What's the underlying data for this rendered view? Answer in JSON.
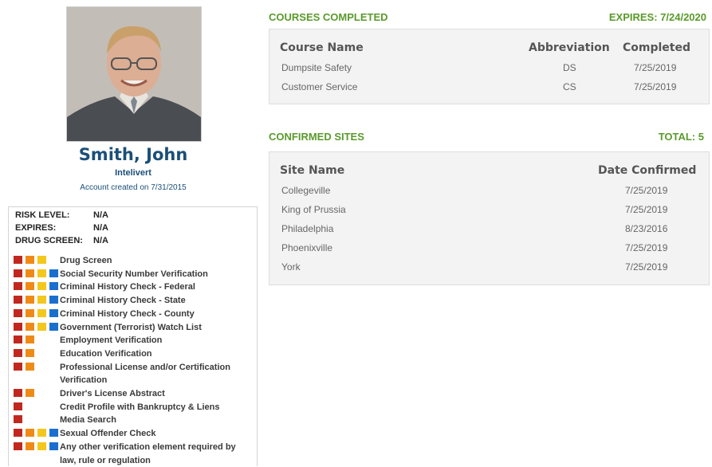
{
  "profile": {
    "name": "Smith, John",
    "company": "Intelivert",
    "created": "Account created on 7/31/2015"
  },
  "risk": {
    "level_label": "RISK LEVEL:",
    "level_value": "N/A",
    "expires_label": "EXPIRES:",
    "expires_value": "N/A",
    "drug_label": "DRUG SCREEN:",
    "drug_value": "N/A"
  },
  "checks": [
    {
      "label": "Drug Screen",
      "colors": [
        "red",
        "orange",
        "yellow"
      ]
    },
    {
      "label": "Social Security Number Verification",
      "colors": [
        "red",
        "orange",
        "yellow",
        "blue"
      ]
    },
    {
      "label": "Criminal History Check - Federal",
      "colors": [
        "red",
        "orange",
        "yellow",
        "blue"
      ]
    },
    {
      "label": "Criminal History Check - State",
      "colors": [
        "red",
        "orange",
        "yellow",
        "blue"
      ]
    },
    {
      "label": "Criminal History Check - County",
      "colors": [
        "red",
        "orange",
        "yellow",
        "blue"
      ]
    },
    {
      "label": "Government (Terrorist) Watch List",
      "colors": [
        "red",
        "orange",
        "yellow",
        "blue"
      ]
    },
    {
      "label": "Employment Verification",
      "colors": [
        "red",
        "orange"
      ]
    },
    {
      "label": "Education Verification",
      "colors": [
        "red",
        "orange"
      ]
    },
    {
      "label": "Professional License and/or Certification Verification",
      "colors": [
        "red",
        "orange"
      ]
    },
    {
      "label": "Driver's License Abstract",
      "colors": [
        "red",
        "orange"
      ]
    },
    {
      "label": "Credit Profile with Bankruptcy & Liens",
      "colors": [
        "red"
      ]
    },
    {
      "label": "Media Search",
      "colors": [
        "red"
      ]
    },
    {
      "label": "Sexual Offender Check",
      "colors": [
        "red",
        "orange",
        "yellow",
        "blue"
      ]
    },
    {
      "label": "Any other verification element required by law, rule or regulation",
      "colors": [
        "red",
        "orange",
        "yellow",
        "blue"
      ]
    }
  ],
  "courses": {
    "title": "COURSES COMPLETED",
    "expires": "EXPIRES: 7/24/2020",
    "headers": {
      "name": "Course Name",
      "abbr": "Abbreviation",
      "completed": "Completed"
    },
    "rows": [
      {
        "name": "Dumpsite Safety",
        "abbr": "DS",
        "completed": "7/25/2019"
      },
      {
        "name": "Customer Service",
        "abbr": "CS",
        "completed": "7/25/2019"
      }
    ]
  },
  "sites": {
    "title": "CONFIRMED SITES",
    "total": "TOTAL: 5",
    "headers": {
      "name": "Site Name",
      "date": "Date Confirmed"
    },
    "rows": [
      {
        "name": "Collegeville",
        "date": "7/25/2019"
      },
      {
        "name": "King of Prussia",
        "date": "7/25/2019"
      },
      {
        "name": "Philadelphia",
        "date": "8/23/2016"
      },
      {
        "name": "Phoenixville",
        "date": "7/25/2019"
      },
      {
        "name": "York",
        "date": "7/25/2019"
      }
    ]
  },
  "colors": {
    "brand": "#1b4f78",
    "section": "#5a9a2a",
    "red": "#c0281f",
    "orange": "#ef8a17",
    "yellow": "#f4c71c",
    "blue": "#1a6fce"
  }
}
